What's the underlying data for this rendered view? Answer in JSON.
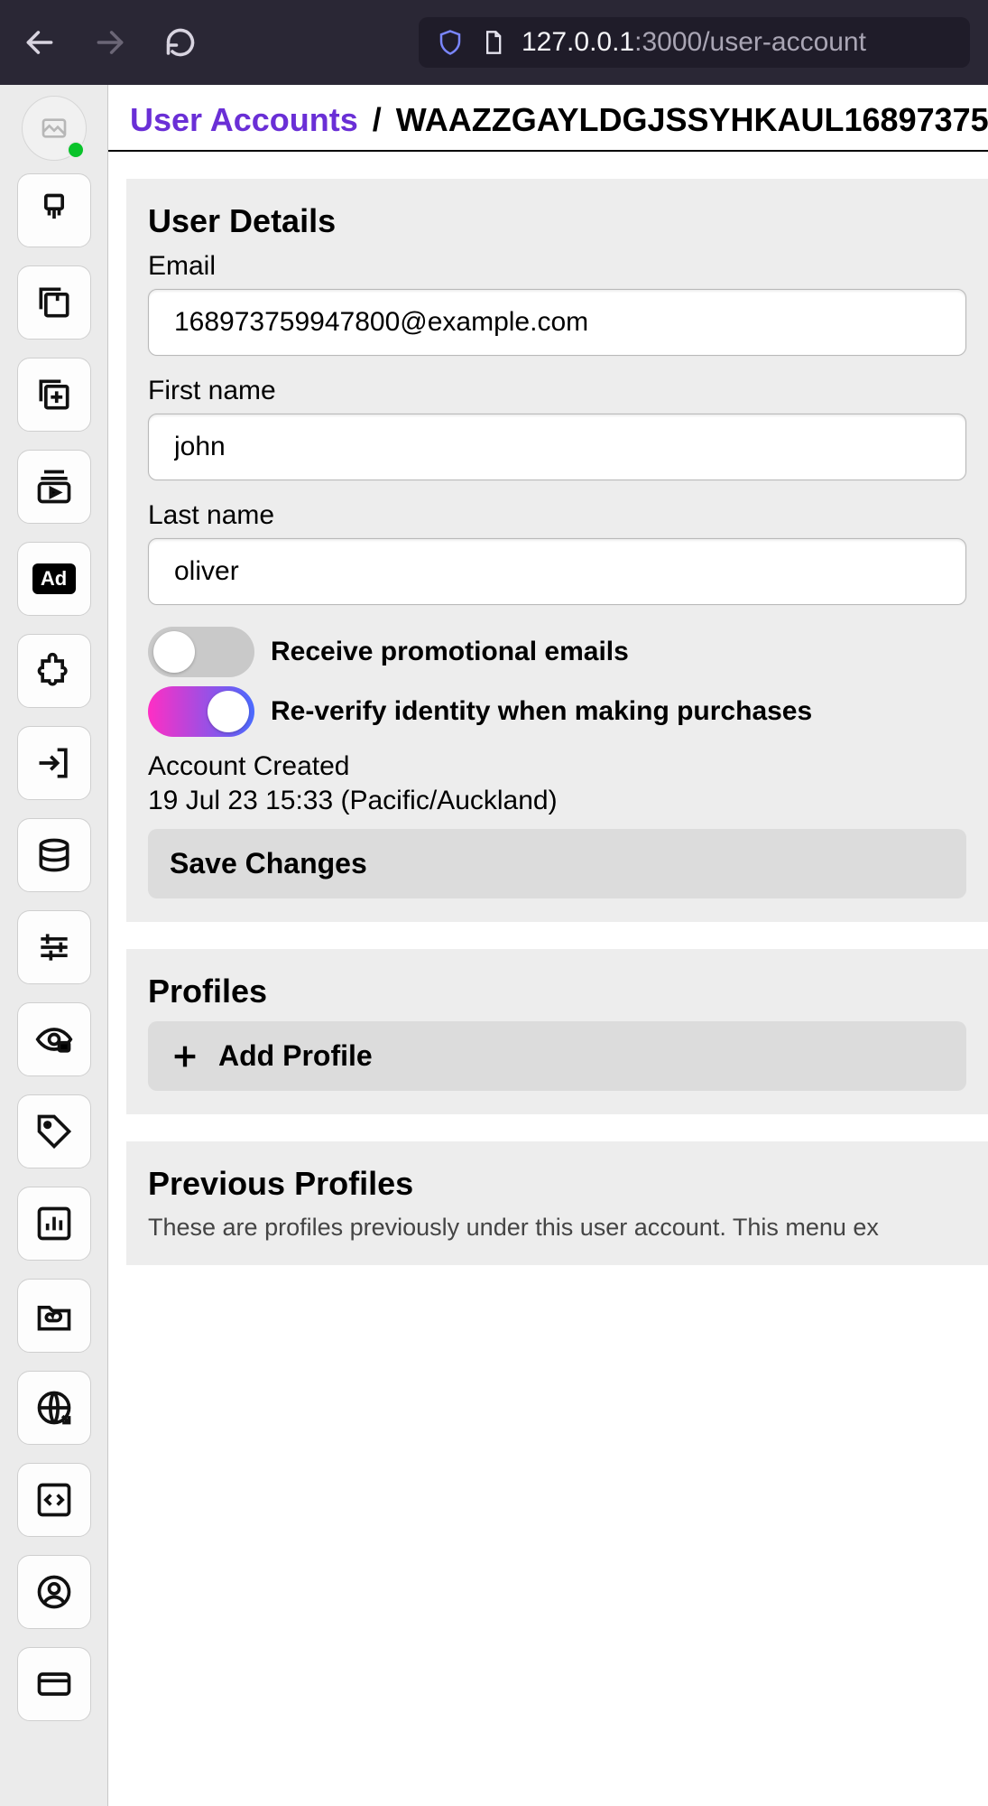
{
  "browser": {
    "url_host": "127.0.0.1",
    "url_rest": ":3000/user-account"
  },
  "breadcrumb": {
    "root": "User Accounts",
    "sep": "/",
    "current": "WAAZZGAYLDGJSSYHKAUL16897375"
  },
  "user_details": {
    "heading": "User Details",
    "email_label": "Email",
    "email_value": "168973759947800@example.com",
    "first_name_label": "First name",
    "first_name_value": "john",
    "last_name_label": "Last name",
    "last_name_value": "oliver",
    "promo_toggle_label": "Receive promotional emails",
    "promo_toggle_on": false,
    "reverify_toggle_label": "Re-verify identity when making purchases",
    "reverify_toggle_on": true,
    "account_created_label": "Account Created",
    "account_created_value": "19 Jul 23 15:33 (Pacific/Auckland)",
    "save_label": "Save Changes"
  },
  "profiles": {
    "heading": "Profiles",
    "add_label": "Add Profile"
  },
  "previous_profiles": {
    "heading": "Previous Profiles",
    "description": "These are profiles previously under this user account. This menu ex"
  },
  "sidebar": {
    "items": [
      "brush-icon",
      "library-icon",
      "add-library-icon",
      "subscriptions-icon",
      "ad-icon",
      "extension-icon",
      "login-icon",
      "database-icon",
      "tune-icon",
      "visibility-lock-icon",
      "tag-icon",
      "analytics-icon",
      "cloud-folder-icon",
      "globe-share-icon",
      "code-icon",
      "account-icon",
      "card-icon"
    ],
    "ad_text": "Ad"
  }
}
